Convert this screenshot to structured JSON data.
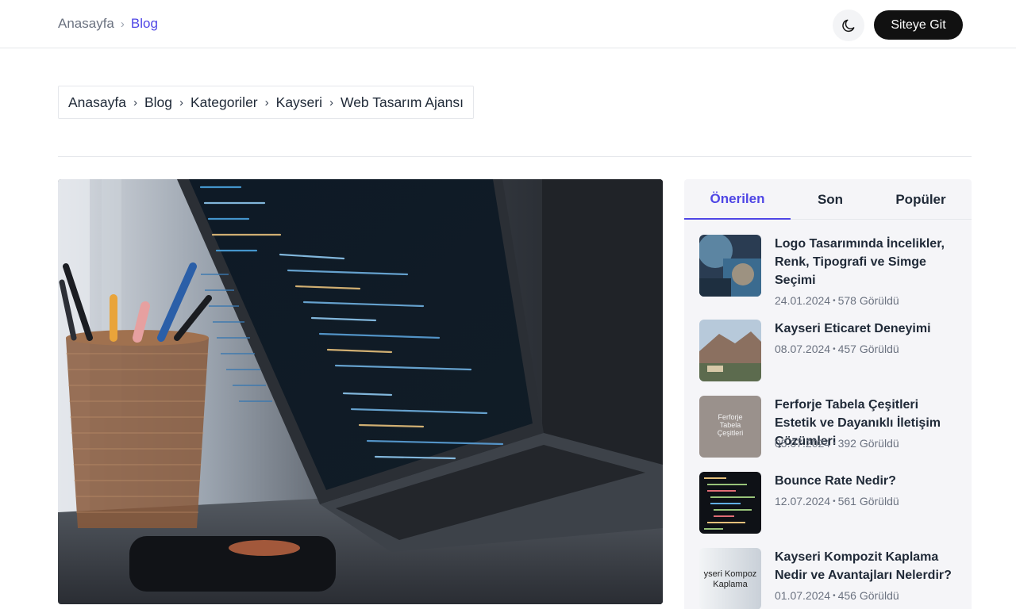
{
  "topbar": {
    "breadcrumb": {
      "home": "Anasayfa",
      "separator": "›",
      "current": "Blog"
    },
    "theme_toggle_icon": "moon-icon",
    "site_button": "Siteye Git"
  },
  "breadcrumb": {
    "items": [
      "Anasayfa",
      "Blog",
      "Kategoriler",
      "Kayseri",
      "Web Tasarım Ajansı"
    ],
    "separator": "›"
  },
  "hero": {
    "alt": "laptop-code-photo"
  },
  "sidebar": {
    "tabs": [
      "Önerilen",
      "Son",
      "Popüler"
    ],
    "active_tab": "Önerilen",
    "posts": [
      {
        "title": "Logo Tasarımında İncelikler, Renk, Tipografi ve Simge Seçimi",
        "date": "24.01.2024",
        "views": "578 Görüldü"
      },
      {
        "title": "Kayseri Eticaret Deneyimi",
        "date": "08.07.2024",
        "views": "457 Görüldü"
      },
      {
        "title": "Ferforje Tabela Çeşitleri Estetik ve Dayanıklı İletişim Çözümleri",
        "date": "05.07.2024",
        "views": "392 Görüldü",
        "thumb_text": [
          "Ferforje",
          "Tabela",
          "Çeşitleri"
        ]
      },
      {
        "title": "Bounce Rate Nedir?",
        "date": "12.07.2024",
        "views": "561 Görüldü"
      },
      {
        "title": "Kayseri Kompozit Kaplama Nedir ve Avantajları Nelerdir?",
        "date": "01.07.2024",
        "views": "456 Görüldü",
        "thumb_text": [
          "yseri Kompoz",
          "Kaplama"
        ]
      }
    ]
  },
  "colors": {
    "accent": "#4f46e5",
    "dark_button": "#111111",
    "sidebar_bg": "#f5f5f8"
  }
}
